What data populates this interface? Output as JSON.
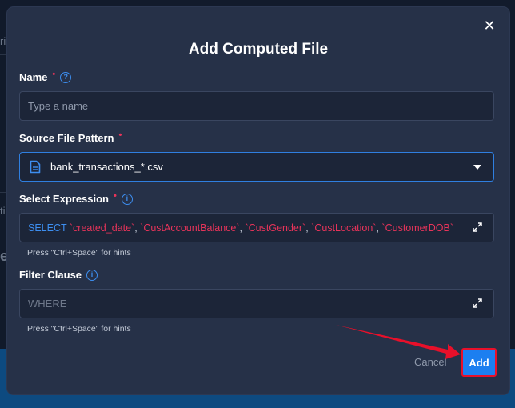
{
  "background": {
    "left_fragment_1": "ri",
    "left_fragment_2": "ti",
    "left_fragment_3": "e"
  },
  "modal": {
    "title": "Add Computed File",
    "close_glyph": "✕",
    "name_field": {
      "label": "Name",
      "required_mark": "•",
      "info_glyph": "?",
      "placeholder": "Type a name",
      "value": ""
    },
    "source_field": {
      "label": "Source File Pattern",
      "required_mark": "•",
      "selected_value": "bank_transactions_*.csv",
      "icon": "file-icon"
    },
    "select_field": {
      "label": "Select Expression",
      "required_mark": "•",
      "info_glyph": "i",
      "keyword": "SELECT",
      "columns": [
        "`created_date`",
        "`CustAccountBalance`",
        "`CustGender`",
        "`CustLocation`",
        "`CustomerDOB`"
      ],
      "separator": ", ",
      "hint": "Press \"Ctrl+Space\" for hints"
    },
    "filter_field": {
      "label": "Filter Clause",
      "info_glyph": "i",
      "placeholder": "WHERE",
      "hint": "Press \"Ctrl+Space\" for hints"
    },
    "buttons": {
      "cancel": "Cancel",
      "add": "Add"
    }
  },
  "colors": {
    "accent": "#1c7ff0",
    "required": "#e8345a",
    "highlight": "#e8102a"
  }
}
